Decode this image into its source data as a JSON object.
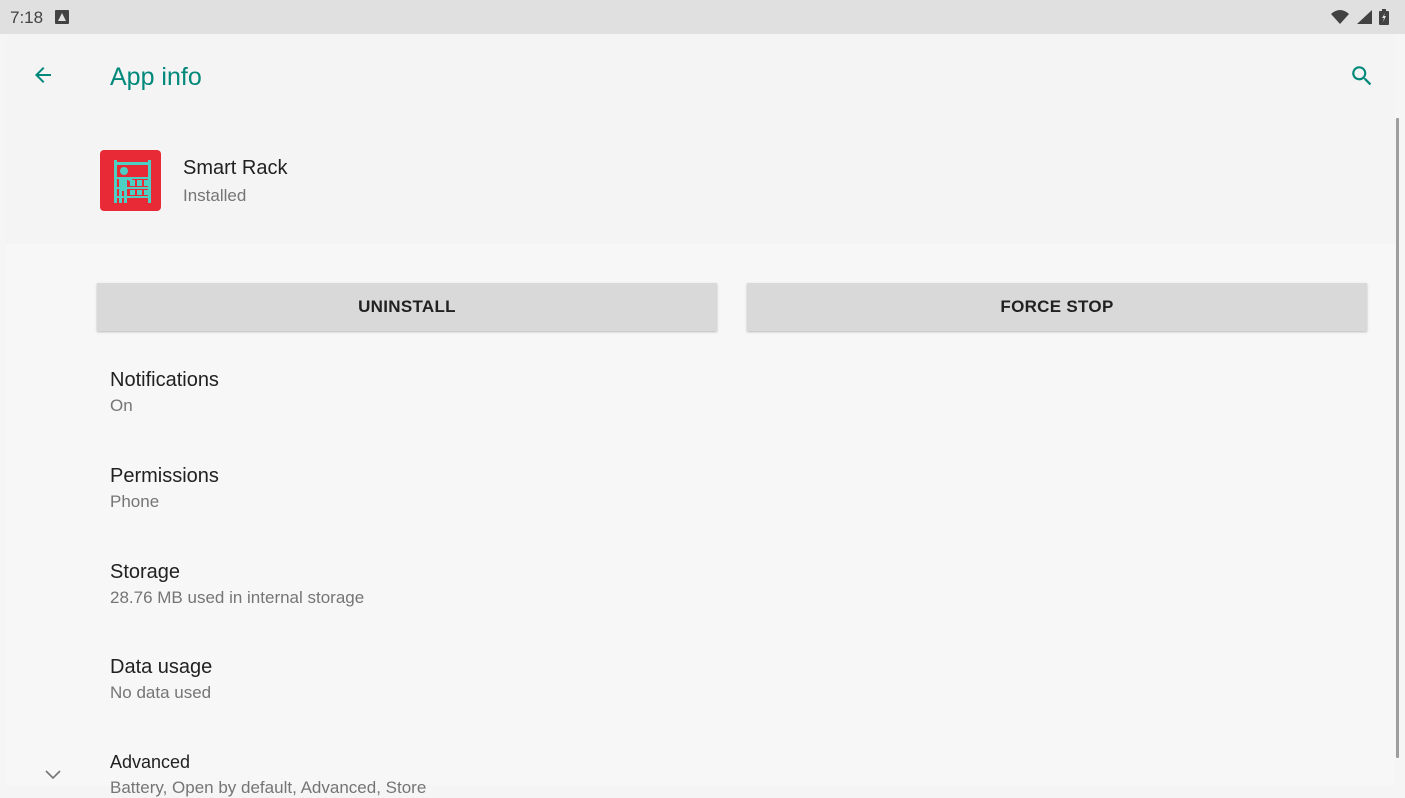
{
  "status_bar": {
    "time": "7:18"
  },
  "toolbar": {
    "title": "App info"
  },
  "app": {
    "name": "Smart Rack",
    "status": "Installed"
  },
  "buttons": {
    "uninstall": "UNINSTALL",
    "force_stop": "FORCE STOP"
  },
  "prefs": [
    {
      "title": "Notifications",
      "summary": "On"
    },
    {
      "title": "Permissions",
      "summary": "Phone"
    },
    {
      "title": "Storage",
      "summary": "28.76 MB used in internal storage"
    },
    {
      "title": "Data usage",
      "summary": "No data used"
    },
    {
      "title": "Advanced",
      "summary": "Battery, Open by default, Advanced, Store"
    }
  ],
  "icons": {
    "back": "back-arrow-icon",
    "search": "search-icon",
    "expand": "chevron-down-icon",
    "wifi": "wifi-icon",
    "signal": "cell-signal-icon",
    "battery": "battery-charging-icon",
    "notification": "android-notification-icon",
    "app": "smart-rack-app-icon"
  },
  "colors": {
    "accent": "#00897b",
    "app_icon_bg": "#e82a36",
    "app_icon_fg": "#4dd0c3",
    "button_bg": "#d9d9d9"
  }
}
